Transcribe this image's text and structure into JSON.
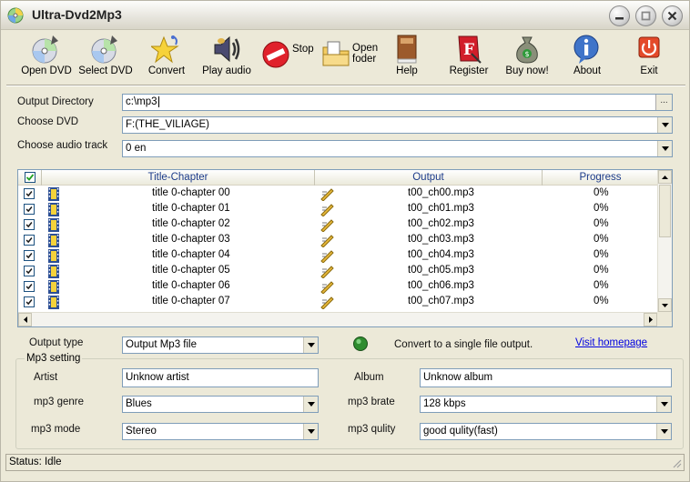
{
  "window": {
    "title": "Ultra-Dvd2Mp3"
  },
  "toolbar": {
    "open_dvd": "Open DVD",
    "select_dvd": "Select DVD",
    "convert": "Convert",
    "play_audio": "Play audio",
    "stop": "Stop",
    "open_folder": "Open foder",
    "help": "Help",
    "register": "Register",
    "buy_now": "Buy now!",
    "about": "About",
    "exit": "Exit"
  },
  "form": {
    "output_dir_label": "Output Directory",
    "output_dir_value": "c:\\mp3",
    "choose_dvd_label": "Choose DVD",
    "choose_dvd_value": "F:(THE_VILIAGE)",
    "audio_track_label": "Choose audio track",
    "audio_track_value": "0 en"
  },
  "list": {
    "columns": [
      "Title-Chapter",
      "Output",
      "Progress"
    ],
    "rows": [
      {
        "title": "title 0-chapter 00",
        "output": "t00_ch00.mp3",
        "progress": "0%"
      },
      {
        "title": "title 0-chapter 01",
        "output": "t00_ch01.mp3",
        "progress": "0%"
      },
      {
        "title": "title 0-chapter 02",
        "output": "t00_ch02.mp3",
        "progress": "0%"
      },
      {
        "title": "title 0-chapter 03",
        "output": "t00_ch03.mp3",
        "progress": "0%"
      },
      {
        "title": "title 0-chapter 04",
        "output": "t00_ch04.mp3",
        "progress": "0%"
      },
      {
        "title": "title 0-chapter 05",
        "output": "t00_ch05.mp3",
        "progress": "0%"
      },
      {
        "title": "title 0-chapter 06",
        "output": "t00_ch06.mp3",
        "progress": "0%"
      },
      {
        "title": "title 0-chapter 07",
        "output": "t00_ch07.mp3",
        "progress": "0%"
      }
    ]
  },
  "output": {
    "type_label": "Output type",
    "type_value": "Output Mp3  file",
    "single_file_label": "Convert to a single file output.",
    "homepage_link": "Visit homepage"
  },
  "mp3": {
    "group_title": "Mp3 setting",
    "artist_label": "Artist",
    "artist_value": "Unknow artist",
    "album_label": "Album",
    "album_value": "Unknow album",
    "genre_label": "mp3 genre",
    "genre_value": "Blues",
    "bitrate_label": "mp3 brate",
    "bitrate_value": "128 kbps",
    "mode_label": "mp3 mode",
    "mode_value": "Stereo",
    "quality_label": "mp3 qulity",
    "quality_value": "good qulity(fast)"
  },
  "status": {
    "text": "Status: Idle"
  },
  "colors": {
    "link": "#0000e0",
    "header_text": "#1c3b8a",
    "field_border": "#7f9db9"
  }
}
